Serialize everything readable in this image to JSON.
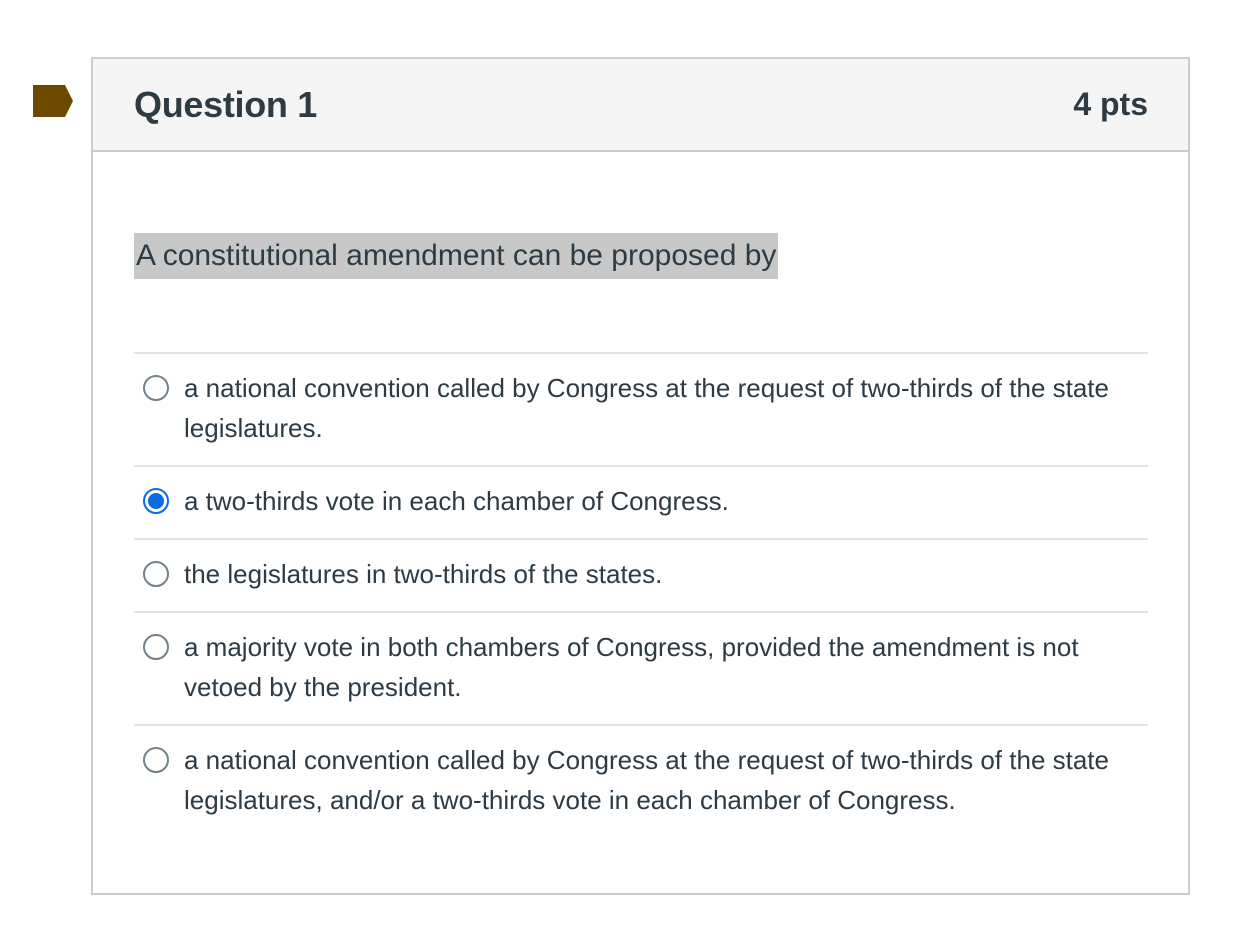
{
  "colors": {
    "flag": "#6b4a00",
    "header_bg": "#f5f5f5",
    "border": "#c7cdd1",
    "text": "#2d3b45",
    "selected_radio": "#0b6be3",
    "question_highlight": "#c8c8c8"
  },
  "question": {
    "title": "Question 1",
    "points": "4 pts",
    "text": "A constitutional amendment can be proposed by",
    "flag_icon": "bookmark-flag-icon"
  },
  "answers": [
    {
      "label": "a national convention called by Congress at the request of two-thirds of the state legislatures.",
      "selected": false
    },
    {
      "label": "a two-thirds vote in each chamber of Congress.",
      "selected": true
    },
    {
      "label": "the legislatures in two-thirds of the states.",
      "selected": false
    },
    {
      "label": "a majority vote in both chambers of Congress, provided the amendment is not vetoed by the president.",
      "selected": false
    },
    {
      "label": "a national convention called by Congress at the request of two-thirds of the state legislatures, and/or a two-thirds vote in each chamber of Congress.",
      "selected": false
    }
  ]
}
